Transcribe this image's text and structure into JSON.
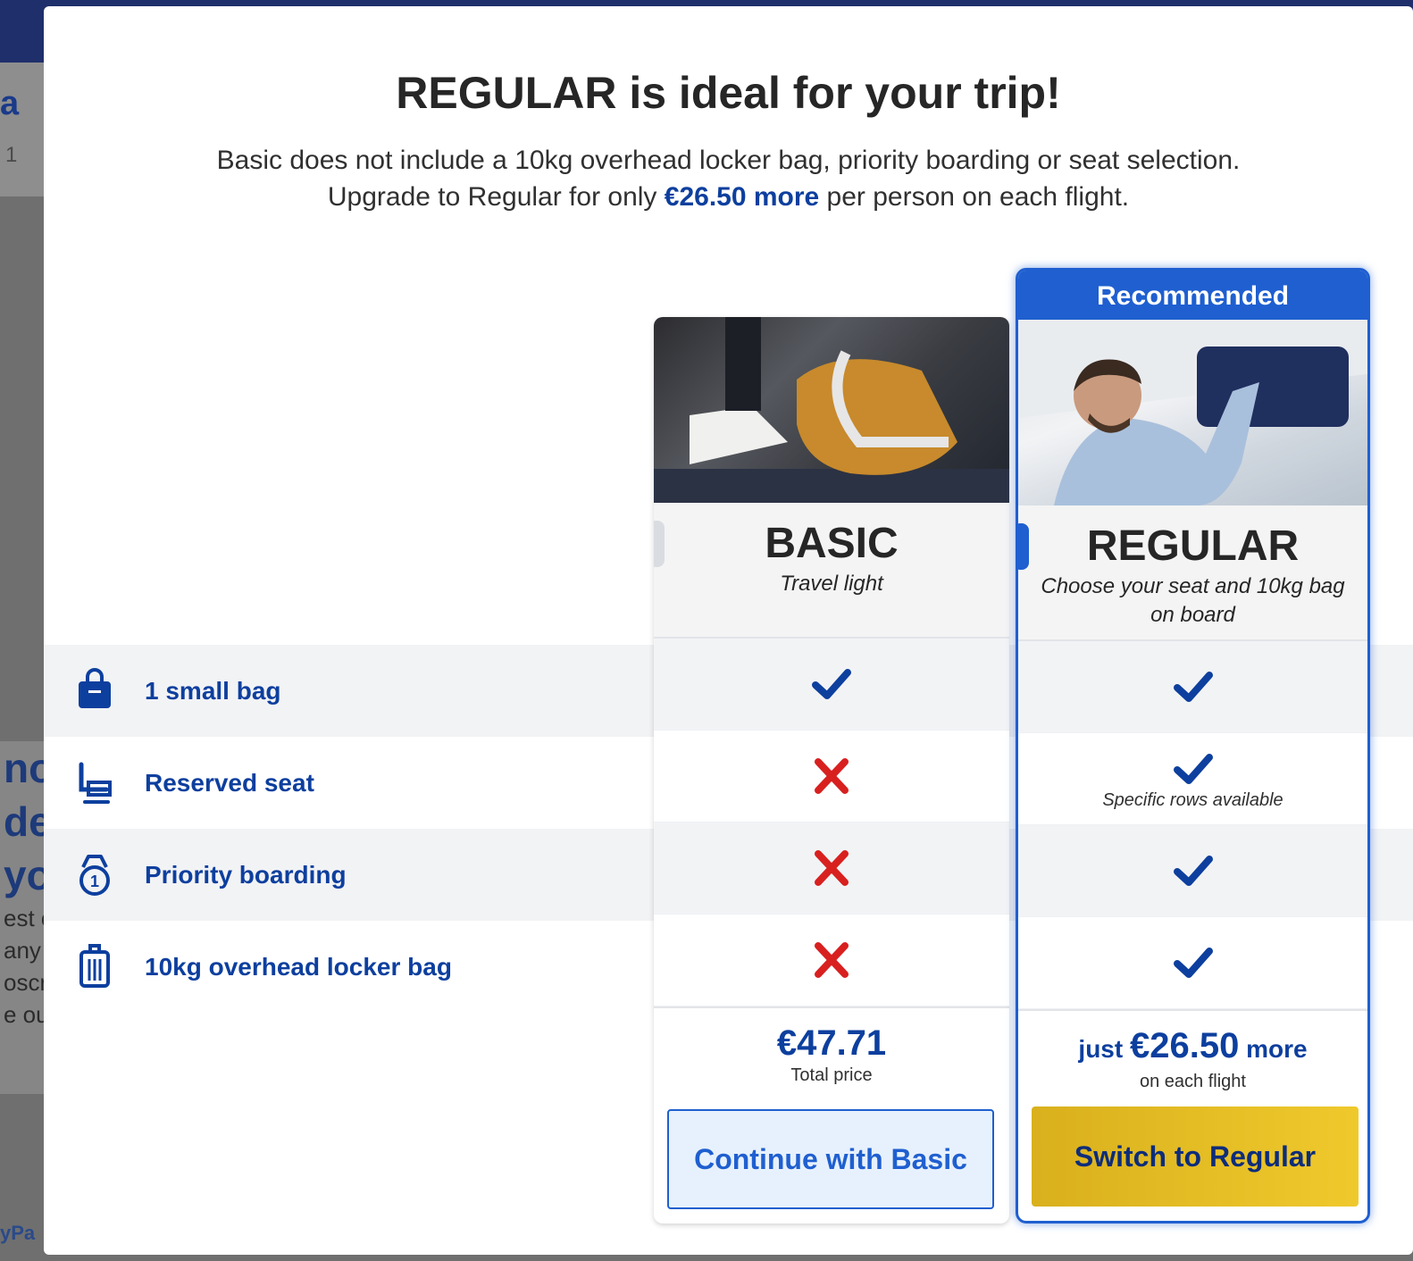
{
  "background": {
    "letter": "a",
    "small": "1",
    "promo_lines": [
      "no",
      "de",
      "yo",
      "est c",
      "any",
      "oscr",
      "e ou"
    ],
    "pay": "yPa"
  },
  "modal": {
    "title": "REGULAR is ideal for your trip!",
    "subtitle_line1": "Basic does not include a 10kg overhead locker bag, priority boarding or seat selection.",
    "subtitle_pre": "Upgrade to Regular for only ",
    "subtitle_highlight": "€26.50 more",
    "subtitle_post": " per person on each flight."
  },
  "features": [
    {
      "label": "1 small bag",
      "icon": "small-bag-icon"
    },
    {
      "label": "Reserved seat",
      "icon": "seat-icon"
    },
    {
      "label": "Priority boarding",
      "icon": "priority-boarding-icon"
    },
    {
      "label": "10kg overhead locker bag",
      "icon": "locker-bag-icon"
    }
  ],
  "plans": {
    "basic": {
      "name": "BASIC",
      "tagline": "Travel light",
      "includes": [
        true,
        false,
        false,
        false
      ],
      "price": "€47.71",
      "price_sub": "Total price",
      "button": "Continue with Basic"
    },
    "regular": {
      "banner": "Recommended",
      "name": "REGULAR",
      "tagline": "Choose your seat and 10kg bag on board",
      "includes": [
        true,
        true,
        true,
        true
      ],
      "seat_note": "Specific rows available",
      "price_prefix": "just ",
      "price": "€26.50",
      "price_suffix": " more",
      "price_sub": "on each flight",
      "button": "Switch to Regular"
    }
  },
  "colors": {
    "brand_blue": "#0d3f9e",
    "accent_blue": "#1f5fd0",
    "check_blue": "#0d3f9e",
    "cross_red": "#d8201f",
    "button_yellow": "#efc92c"
  }
}
